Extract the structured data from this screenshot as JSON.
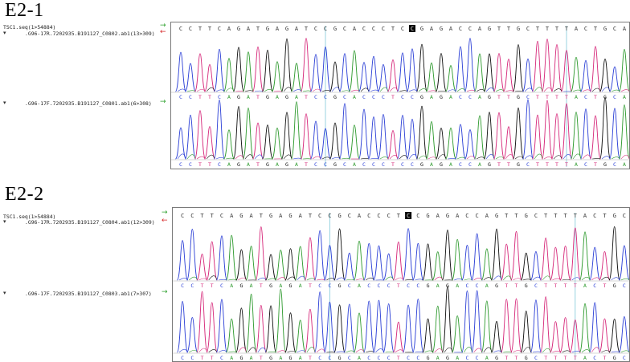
{
  "panels": [
    {
      "heading": "E2-1",
      "reference_label": "TSC1.seq(1>54884)",
      "reads": [
        {
          "name": ".G96-17R.7202935.B191127_C0802.ab1(13>309)",
          "direction": "reverse"
        },
        {
          "name": ".G96-17F.7202935.B191127_C0801.ab1(6>308)",
          "direction": "forward"
        }
      ],
      "reference_seq": "CCTTCAGATGAGATCCGCACCCTCCGAGACCAGTTGCTTTTACTGCA",
      "read1_seq": "CCTTCAGATGAGATCCGCACCCTCCGAGACCAGTTGCTTTTACTGCA",
      "read2_seq": "CCTTCAGATGAGATCCGCACCCTCCGAGACCAGTTGCTTTTACTGCA",
      "highlight_index": 24
    },
    {
      "heading": "E2-2",
      "reference_label": "TSC1.seq(1>54884)",
      "reads": [
        {
          "name": ".G96-17R.7202935.B191127_C0804.ab1(12>309)",
          "direction": "reverse"
        },
        {
          "name": ".G96-17F.7202935.B191127_C0803.ab1(7>307)",
          "direction": "forward"
        }
      ],
      "reference_seq": "CCTTCAGATGAGATCCGCACCCTCCGAGACCAGTTGCTTTTACTGC",
      "read1_seq": "CCTTCAGATGAGATCCGCACCCTCCGAGACCAGTTGCTTTTACTGC",
      "read2_seq": "CCTTCAGATGAGATCCGCACCCTCCGAGACCAGTTGCTTTTACTGC",
      "highlight_index": 23
    }
  ],
  "colors": {
    "A": "#2e9a2e",
    "C": "#2b3fd6",
    "G": "#111111",
    "T": "#d6287a",
    "cursor": "#7fc8d8",
    "forward_arrow": "#2ca02c",
    "reverse_arrow": "#d62728"
  },
  "icons": {
    "forward_arrow": "→",
    "reverse_arrow": "←",
    "row_bullet": "▾"
  }
}
